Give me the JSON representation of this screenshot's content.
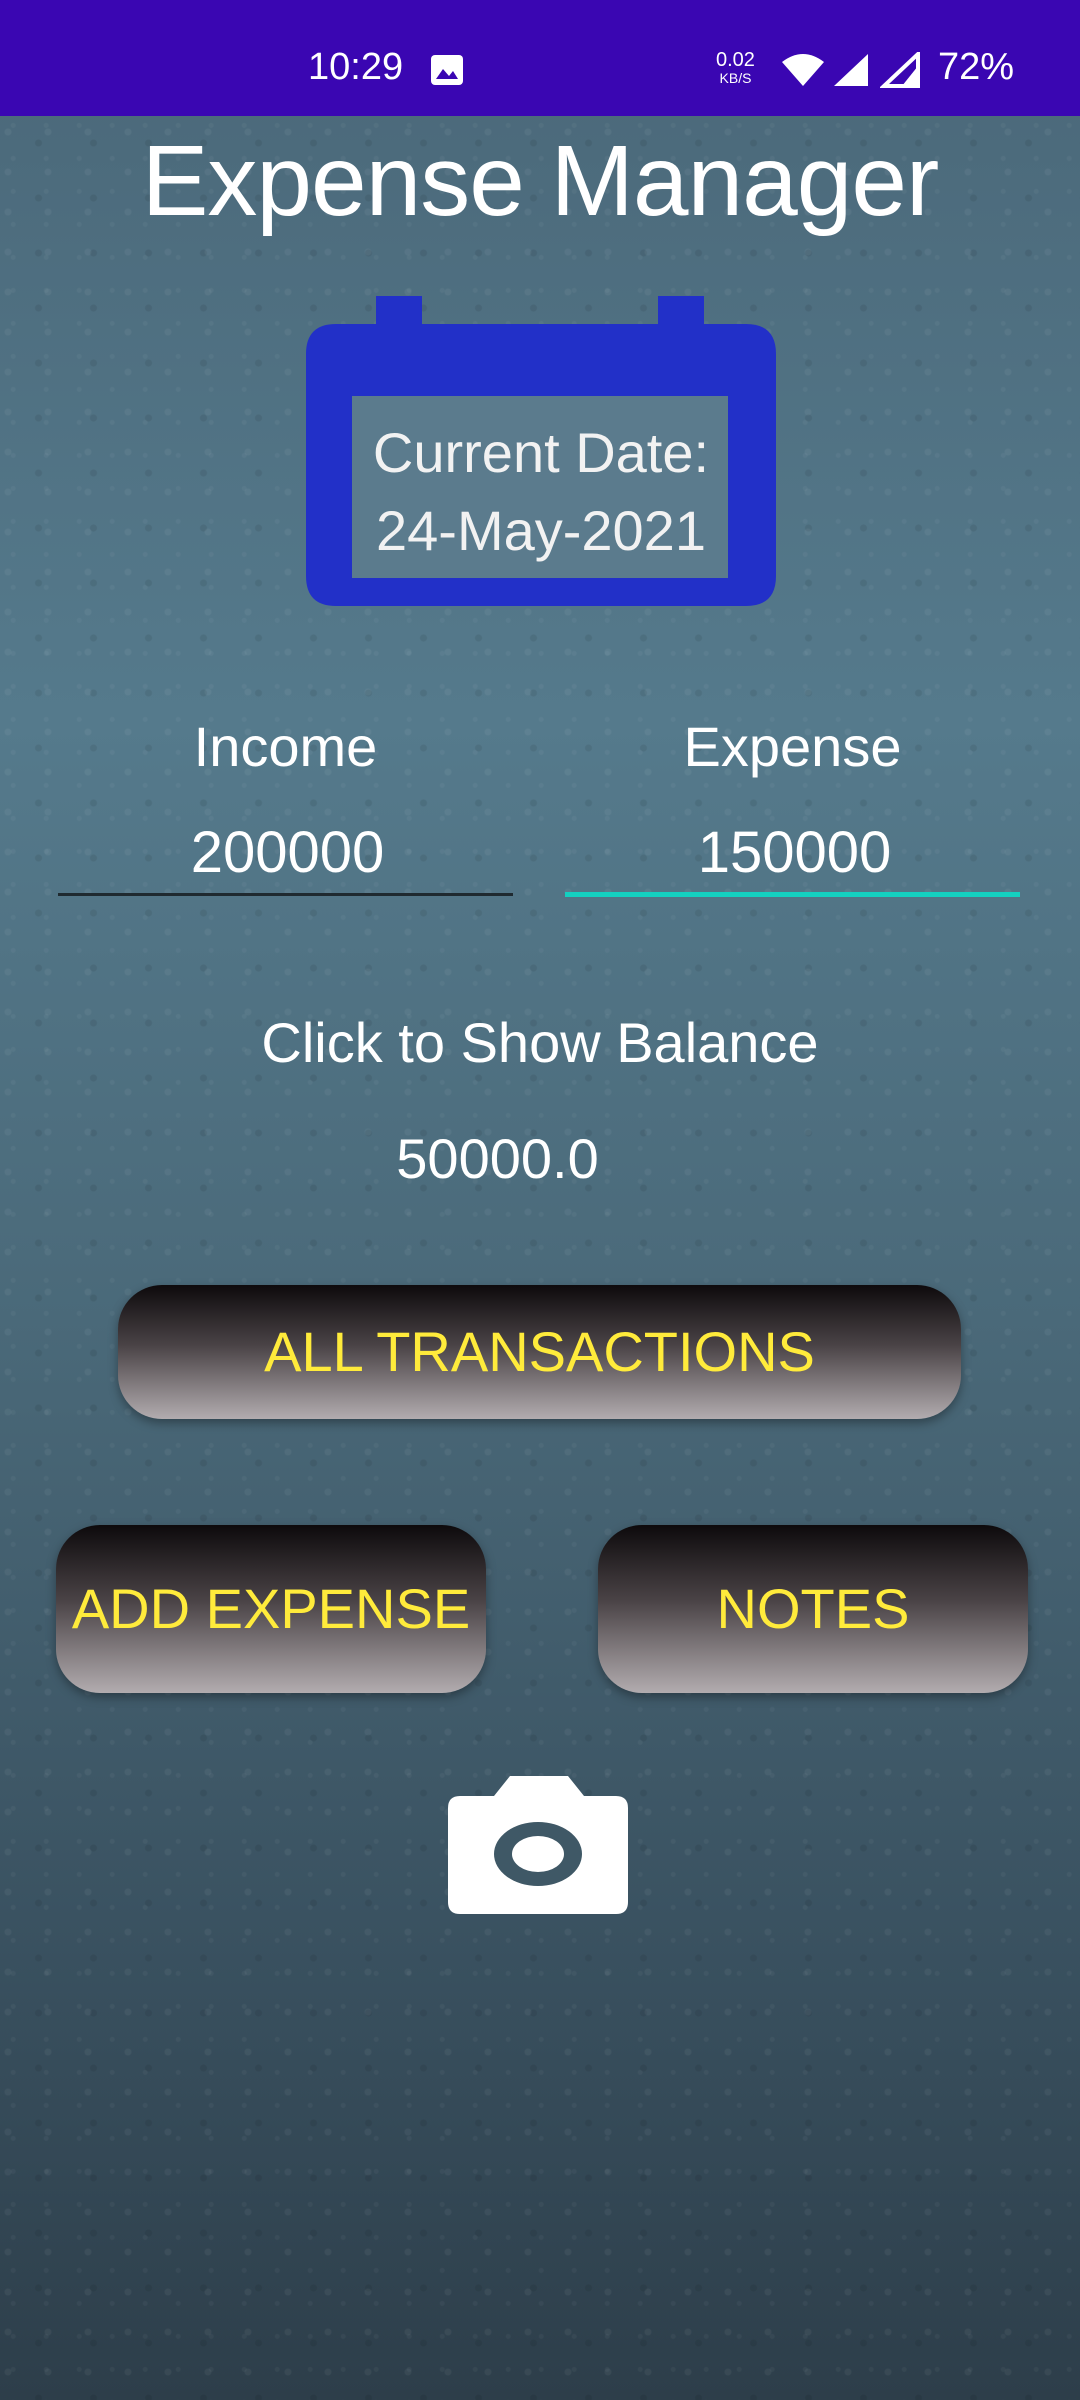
{
  "status_bar": {
    "time": "10:29",
    "net_speed_value": "0.02",
    "net_speed_unit": "KB/S",
    "battery": "72%"
  },
  "app": {
    "title": "Expense Manager"
  },
  "date_card": {
    "label": "Current Date:",
    "date": "24-May-2021",
    "color": "#2230c8"
  },
  "income": {
    "label": "Income",
    "value": "200000"
  },
  "expense": {
    "label": "Expense",
    "value": "150000"
  },
  "balance": {
    "button_label": "Click to Show Balance",
    "value": "50000.0"
  },
  "buttons": {
    "all_transactions": "ALL TRANSACTIONS",
    "add_expense": "ADD EXPENSE",
    "notes": "NOTES"
  },
  "colors": {
    "status_bar": "#3a06b2",
    "accent_underline": "#14d0c0",
    "button_text": "#ffeb3b"
  },
  "icons": [
    "image-icon",
    "wifi-icon",
    "signal-icon",
    "calendar-icon",
    "camera-icon"
  ]
}
